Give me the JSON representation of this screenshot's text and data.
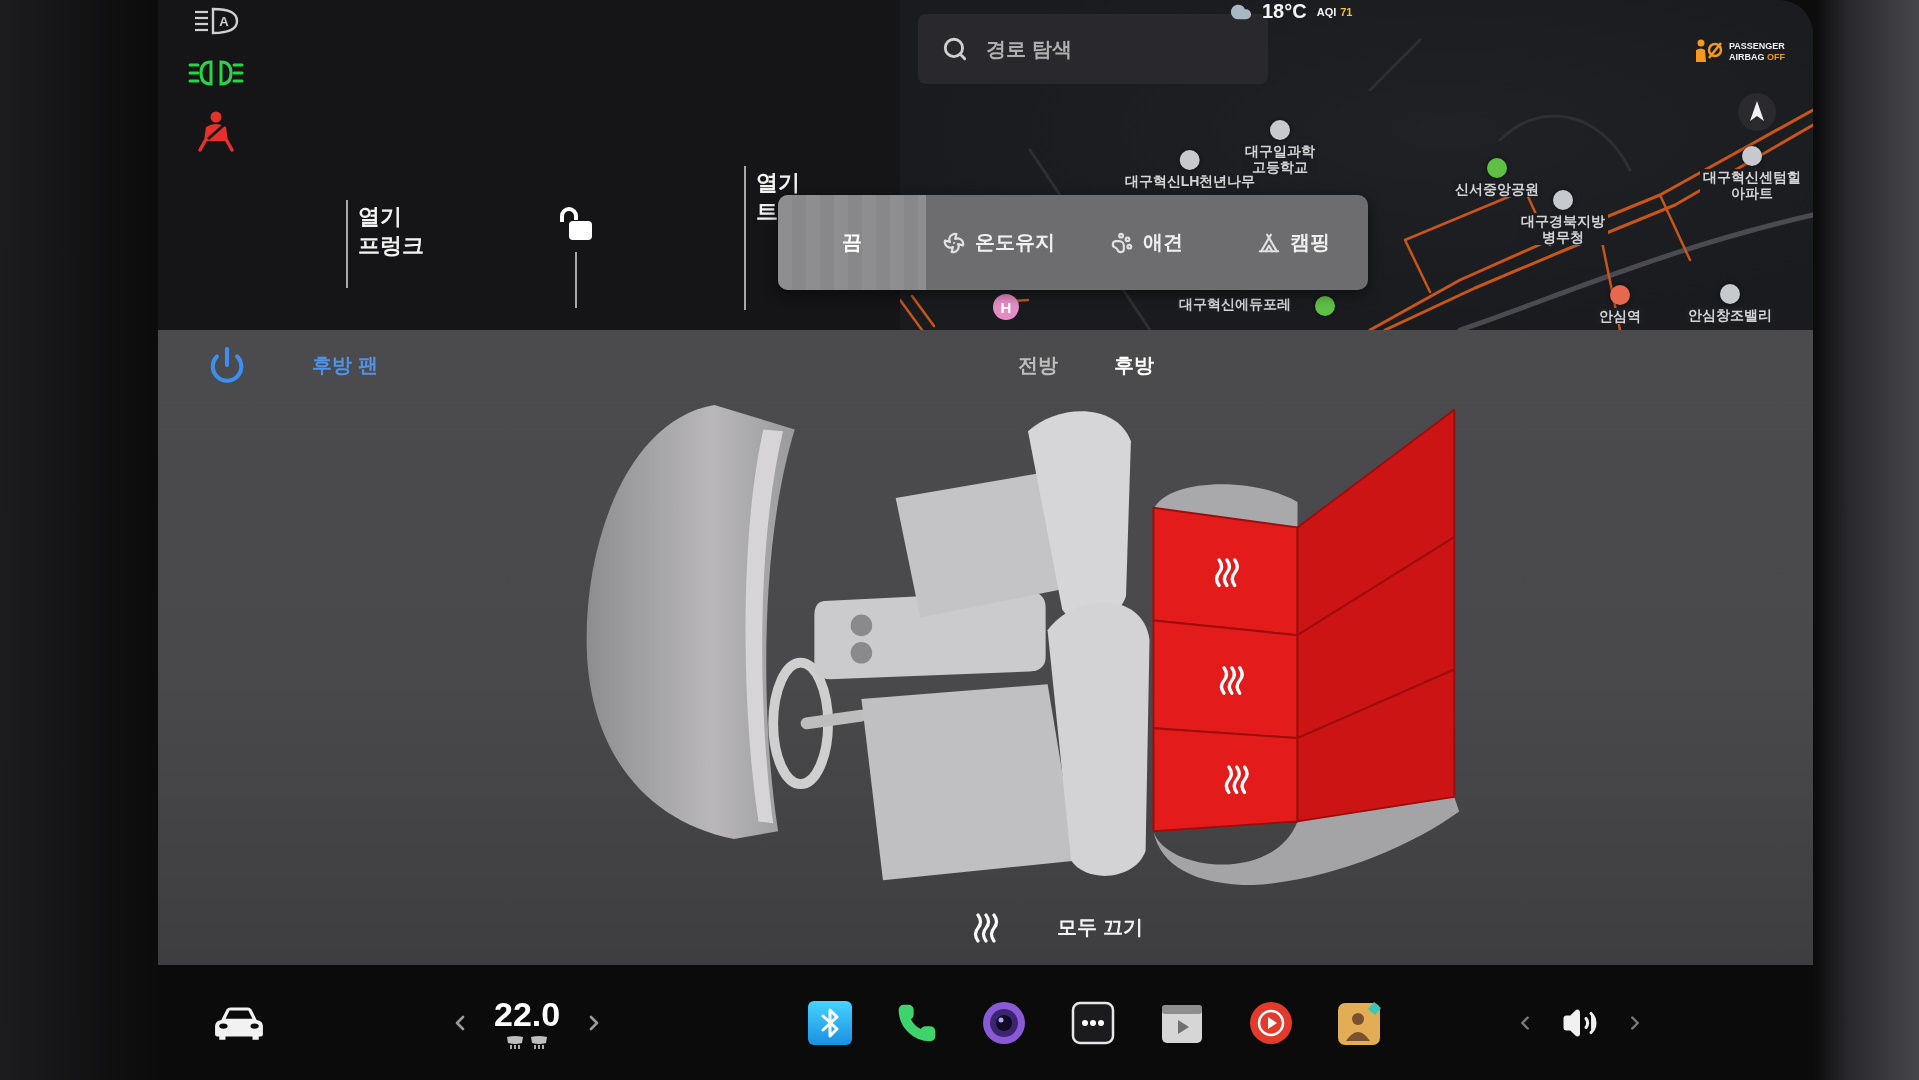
{
  "indicators": {
    "auto_headlight_letter": "A"
  },
  "vehicle_labels": [
    {
      "action": "열기",
      "part": "프렁크"
    },
    {
      "action": "열기",
      "part": "트"
    }
  ],
  "status": {
    "outside_temperature": "18°C",
    "aqi_label": "AQI",
    "aqi_value": "71"
  },
  "map": {
    "search": {
      "placeholder": "경로 탐색"
    },
    "airbag": {
      "line_1": "PASSENGER",
      "line_2": "AIRBAG",
      "status": "OFF"
    },
    "places": [
      {
        "label": "대구일과학\n고등학교",
        "color": "#c6cacf"
      },
      {
        "label": "대구혁신LH천년나무",
        "color": "#c6cacf"
      },
      {
        "label": "신서중앙공원",
        "color": "#5fbf45"
      },
      {
        "label": "대구경북지방\n병무청",
        "color": "#c6cacf"
      },
      {
        "label": "대구혁신센텀힐\n아파트",
        "color": "#c6cacf"
      },
      {
        "badge": "H",
        "color": "#e58cc6"
      },
      {
        "label": "대구혁신에듀포레"
      },
      {
        "color": "#5fbf45"
      },
      {
        "label": "안심역",
        "color": "#e8674f"
      },
      {
        "label": "안심창조밸리",
        "color": "#c6cacf"
      }
    ]
  },
  "climate_modes": [
    {
      "kind": "off",
      "label": "끔",
      "selected": true
    },
    {
      "kind": "keep",
      "label": "온도유지",
      "selected": false
    },
    {
      "kind": "dog",
      "label": "애견",
      "selected": false
    },
    {
      "kind": "camp",
      "label": "캠핑",
      "selected": false
    }
  ],
  "rear_fan": {
    "label": "후방 팬"
  },
  "seat_views": [
    {
      "label": "전방",
      "selected": false
    },
    {
      "label": "후방",
      "selected": true
    }
  ],
  "rear_seats": [
    {
      "heated": true
    },
    {
      "heated": true
    },
    {
      "heated": true
    }
  ],
  "all_off": {
    "label": "모두 끄기"
  },
  "cabin_temperature": "22.0"
}
